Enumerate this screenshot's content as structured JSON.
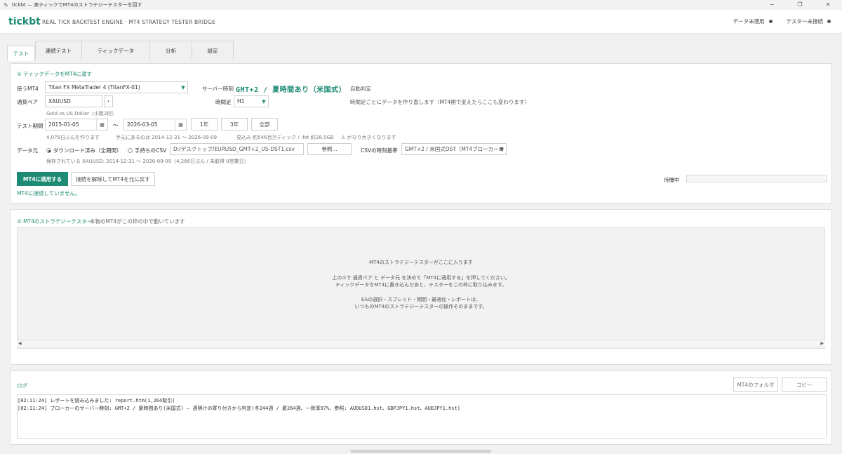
{
  "window": {
    "title": "tickbt — 実ティックでMT4のストラテジーテスターを回す",
    "app_icon": "feather-icon",
    "controls": [
      "−",
      "❐",
      "✕"
    ]
  },
  "header": {
    "brand": "tickbt",
    "subtitle": "REAL TICK BACKTEST ENGINE · MT4 STRATEGY TESTER BRIDGE",
    "data_status": "データ未適用",
    "tester_status": "テスター未接続"
  },
  "tabs": [
    {
      "label": "テスト",
      "active": true
    },
    {
      "label": "連続テスト"
    },
    {
      "label": "ティックデータ"
    },
    {
      "label": "分析"
    },
    {
      "label": "設定"
    }
  ],
  "section1": {
    "title": "① ティックデータをMT4に渡す",
    "mt4_label": "使うMT4",
    "mt4_value": "Titan FX MetaTrader 4 (TitanFX-01)",
    "server_time_label": "サーバー時刻",
    "server_time_value": "GMT+2 / 夏時間あり（米国式）",
    "auto_detect": "自動判定",
    "pair_label": "通貨ペア",
    "pair_value": "XAUUSD",
    "pair_btn": "・",
    "pair_desc": "Gold vs US Dollar（小数2桁）",
    "timeframe_label": "時間足",
    "timeframe_value": "H1",
    "timeframe_note": "時間足ごとにデータを作り直します（MT4側で変えたらここも変わります）",
    "period_label": "テスト期間",
    "date_from": "2015-01-05",
    "tilde": "〜",
    "date_to": "2026-03-05",
    "preset_1y": "1年",
    "preset_3y": "3年",
    "preset_all": "全部",
    "period_info_1": "4,078日ぶんを作ります",
    "period_info_2": "手元にあるのは 2014-12-31 〜 2026-09-09",
    "period_info_3": "見込み 約546百万ティック / .fxt 約28.5GB",
    "period_info_4": "⚠ かなり大きくなります",
    "source_label": "データ元",
    "source_opt1": "ダウンロード済み（全期間）",
    "source_opt2": "手持ちのCSV",
    "csv_path": "D:/デスクトップ/EURUSD_GMT+2_US-DST1.csv",
    "browse": "参照...",
    "csv_tz_label": "CSVの時刻基準",
    "csv_tz_value": "GMT+2 / 米国式DST（MT4ブローカーの",
    "stored_info": "保存されている XAUUSD: 2014-12-31 〜 2026-09-09（4,266日ぶん / 未取得 0営業日）",
    "apply_btn": "MT4に適用する",
    "restore_btn": "接続を解除してMT4を元に戻す",
    "state_label": "待機中",
    "not_connected": "MT4に接続していません。"
  },
  "section2": {
    "title": "② MT4のストラテジーテスター",
    "note": "本物のMT4がこの枠の中で動いています",
    "placeholder_title": "MT4のストラテジーテスターがここに入ります",
    "placeholder_line1": "上の①で 通貨ペア と データ元 を決めて「MT4に適用する」を押してください。",
    "placeholder_line2": "ティックデータをMT4に書き込んだあと、テスターをこの枠に取り込みます。",
    "placeholder_line3": "EAの選択・スプレッド・期間・最適化・レポートは、",
    "placeholder_line4": "いつものMT4のストラテジーテスターの操作そのままです。"
  },
  "log": {
    "title": "ログ",
    "folder_btn": "MT4のフォルダ",
    "copy_btn": "コピー",
    "lines": [
      "[02:11:24] レポートを読み込みました: report.htm(1,264取引)",
      "[02:11:24] ブローカーのサーバー時刻: GMT+2 / 夏時間あり(米国式) — 週明けの寄り付きから判定(冬244週 / 夏264週、一致率97%、参照: AUDUSD1.hst、GBPJPY1.hst、AUDJPY1.hst)"
    ]
  },
  "colors": {
    "accent": "#1e8c74",
    "dot": "#555555"
  }
}
